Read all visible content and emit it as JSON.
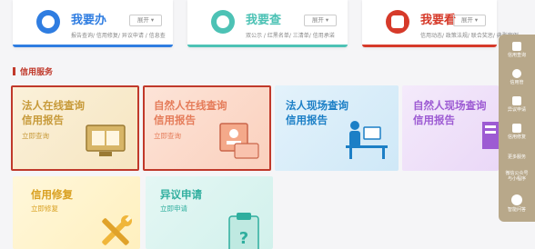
{
  "colors": {
    "red": "#d63a2a",
    "orange": "#e8a33a",
    "teal": "#4dc2b5",
    "gold": "#c7a23a",
    "side": "#b8a88a"
  },
  "top_cards": [
    {
      "title": "我要办",
      "expand": "展开 ▾",
      "links": "报告查询/ 信用修复/ 异议申请 / 信息查",
      "icon": "user-icon"
    },
    {
      "title": "我要查",
      "expand": "展开 ▾",
      "links": "双公示 / 红黑名单/ 三清单/ 信用承诺",
      "icon": "question-icon"
    },
    {
      "title": "我要看",
      "expand": "展开 ▾",
      "links": "信用动态/ 政策法规/ 联合奖惩/ 典型案例",
      "icon": "book-icon"
    }
  ],
  "section": {
    "title": "信用服务"
  },
  "tiles": [
    {
      "line1": "法人在线查询",
      "line2": "信用报告",
      "go": "立即查询"
    },
    {
      "line1": "自然人在线查询",
      "line2": "信用报告",
      "go": "立即查询"
    },
    {
      "line1": "法人现场查询",
      "line2": "信用报告",
      "go": ""
    },
    {
      "line1": "自然人现场查询",
      "line2": "信用报告",
      "go": ""
    },
    {
      "line1": "信用修复",
      "line2": "",
      "go": "立即修复"
    },
    {
      "line1": "异议申请",
      "line2": "",
      "go": "立即申请"
    }
  ],
  "side_panel": {
    "items": [
      {
        "label": "信用查询",
        "icon": "search-doc-icon"
      },
      {
        "label": "信用管",
        "icon": "user-icon"
      },
      {
        "label": "异议申请",
        "icon": "edit-icon"
      },
      {
        "label": "信用修复",
        "icon": "doc-icon"
      },
      {
        "label": "更多服务",
        "icon": ""
      },
      {
        "label": "微信公众号与小程序",
        "icon": ""
      },
      {
        "label": "智能问答",
        "icon": "robot-icon"
      }
    ]
  }
}
